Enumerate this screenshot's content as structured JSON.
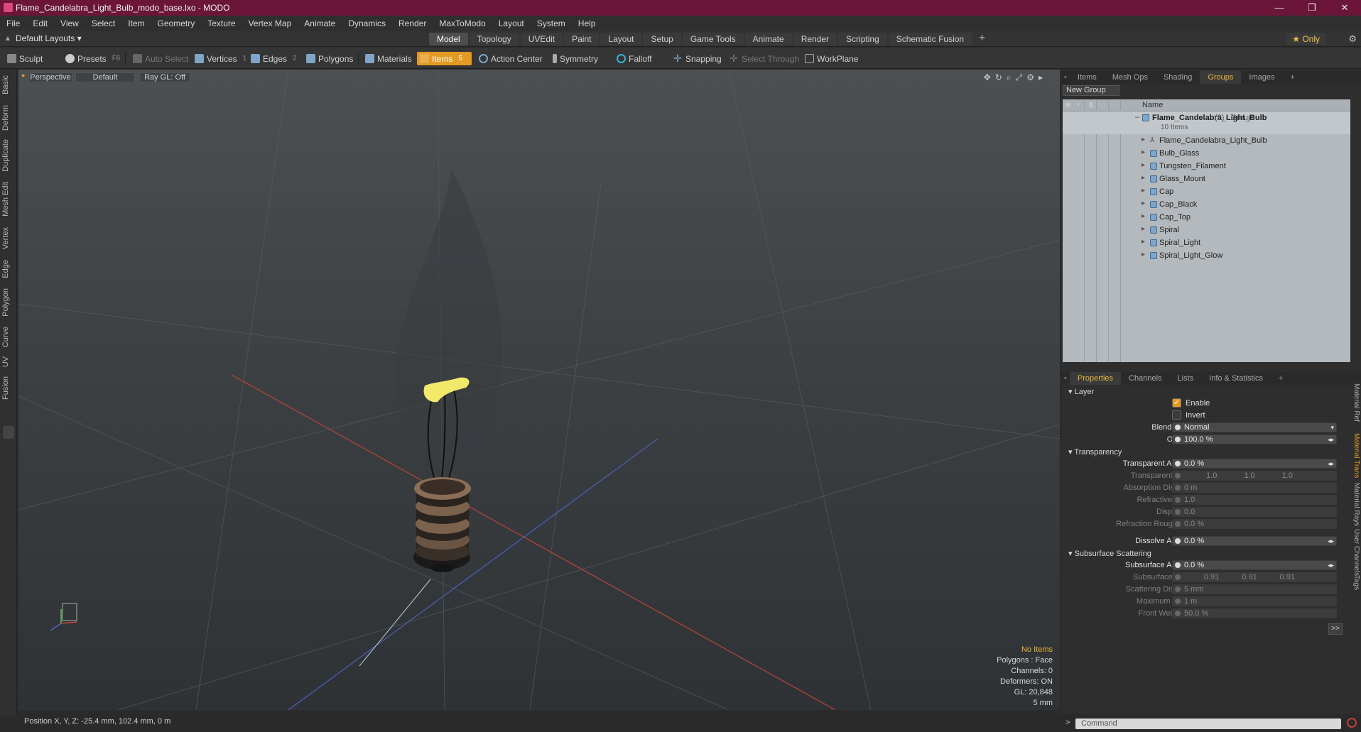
{
  "window": {
    "title": "Flame_Candelabra_Light_Bulb_modo_base.lxo - MODO",
    "min": "—",
    "max": "❐",
    "close": "✕"
  },
  "menu": [
    "File",
    "Edit",
    "View",
    "Select",
    "Item",
    "Geometry",
    "Texture",
    "Vertex Map",
    "Animate",
    "Dynamics",
    "Render",
    "MaxToModo",
    "Layout",
    "System",
    "Help"
  ],
  "layout": {
    "label": "Default Layouts ▾",
    "only": "★ Only",
    "tabs": [
      "Model",
      "Topology",
      "UVEdit",
      "Paint",
      "Layout",
      "Setup",
      "Game Tools",
      "Animate",
      "Render",
      "Scripting",
      "Schematic Fusion"
    ]
  },
  "toolbar": {
    "sculpt": "Sculpt",
    "presets": "Presets",
    "presets_key": "F6",
    "auto_select": "Auto Select",
    "vertices": "Vertices",
    "vertices_key": "1",
    "edges": "Edges",
    "edges_key": "2",
    "polygons": "Polygons",
    "materials": "Materials",
    "items": "Items",
    "items_key": "5",
    "action_center": "Action Center",
    "symmetry": "Symmetry",
    "falloff": "Falloff",
    "snapping": "Snapping",
    "select_through": "Select Through",
    "workplane": "WorkPlane"
  },
  "left_tabs": [
    "Basic",
    "Deform",
    "Duplicate",
    "Mesh Edit",
    "Vertex",
    "Edge",
    "Polygon",
    "Curve",
    "UV",
    "Fusion"
  ],
  "viewport": {
    "perspective": "Perspective",
    "shading": "Default",
    "raygl": "Ray GL: Off",
    "info": {
      "items": "No Items",
      "polygons": "Polygons : Face",
      "channels": "Channels: 0",
      "deformers": "Deformers: ON",
      "gl": "GL: 20,848",
      "scale": "5 mm"
    }
  },
  "status": {
    "position": "Position X, Y, Z:   -25.4 mm, 102.4 mm, 0 m"
  },
  "top_panel": {
    "tabs": [
      "Items",
      "Mesh Ops",
      "Shading",
      "Groups",
      "Images",
      "+"
    ],
    "new_group": "New Group",
    "name_header": "Name",
    "group": {
      "name": "Flame_Candelabra_Light_Bulb",
      "count": "(2) : Group",
      "sub": "10 Items"
    },
    "items": [
      "Flame_Candelabra_Light_Bulb",
      "Bulb_Glass",
      "Tungsten_Filament",
      "Glass_Mount",
      "Cap",
      "Cap_Black",
      "Cap_Top",
      "Spiral",
      "Spiral_Light",
      "Spiral_Light_Glow"
    ]
  },
  "props_panel": {
    "tabs": [
      "Properties",
      "Channels",
      "Lists",
      "Info & Statistics",
      "+"
    ],
    "layer": "Layer",
    "enable": "Enable",
    "invert": "Invert",
    "blend_mode_label": "Blend Mode",
    "blend_mode": "Normal",
    "opacity_label": "Opacity",
    "opacity": "100.0 %",
    "transparency": "Transparency",
    "transparent_amount_label": "Transparent Amount",
    "transparent_amount": "0.0 %",
    "transparent_color_label": "Transparent Color",
    "transparent_color": [
      "1.0",
      "1.0",
      "1.0"
    ],
    "absorption_label": "Absorption Distance",
    "absorption": "0 m",
    "refractive_label": "Refractive Index",
    "refractive": "1.0",
    "dispersion_label": "Dispersion",
    "dispersion": "0.0",
    "refraction_rough_label": "Refraction Roughness",
    "refraction_rough": "0.0 %",
    "dissolve_label": "Dissolve Amount",
    "dissolve": "0.0 %",
    "subsurface": "Subsurface Scattering",
    "subsurface_amount_label": "Subsurface Amount",
    "subsurface_amount": "0.0 %",
    "subsurface_color_label": "Subsurface Color",
    "subsurface_color": [
      "0.91",
      "0.91",
      "0.91"
    ],
    "scatter_dist_label": "Scattering Distance",
    "scatter_dist": "5 mm",
    "max_depth_label": "Maximum Depth",
    "max_depth": "1 m",
    "front_weight_label": "Front Weighting",
    "front_weight": "50.0 %",
    "more": ">>"
  },
  "side_tabs": [
    "Material Ref",
    "Material Trans",
    "Material Rays",
    "User Channels",
    "Tags"
  ],
  "command": {
    "prompt": ">",
    "placeholder": "Command"
  },
  "colors": {
    "title": "#6b1638",
    "accent": "#e49a22",
    "bulb": "#f2e96a"
  }
}
